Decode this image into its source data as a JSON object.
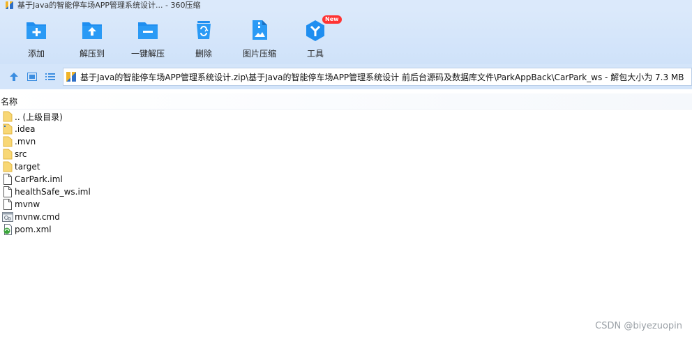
{
  "window": {
    "title": "基于Java的智能停车场APP管理系统设计... - 360压缩"
  },
  "toolbar": {
    "items": [
      {
        "label": "添加",
        "icon": "add-icon"
      },
      {
        "label": "解压到",
        "icon": "extract-to-icon"
      },
      {
        "label": "一键解压",
        "icon": "one-click-extract-icon"
      },
      {
        "label": "删除",
        "icon": "delete-icon"
      },
      {
        "label": "图片压缩",
        "icon": "image-compress-icon"
      },
      {
        "label": "工具",
        "icon": "tools-icon",
        "badge": "New"
      }
    ],
    "accent": "#1f8ef0"
  },
  "address": {
    "path": "基于Java的智能停车场APP管理系统设计.zip\\基于Java的智能停车场APP管理系统设计 前后台源码及数据库文件\\ParkAppBack\\CarPark_ws - 解包大小为 7.3 MB"
  },
  "list": {
    "column_name": "名称",
    "items": [
      {
        "name": ".. (上级目录)",
        "type": "folder"
      },
      {
        "name": ".idea",
        "type": "folder"
      },
      {
        "name": ".mvn",
        "type": "folder"
      },
      {
        "name": "src",
        "type": "folder"
      },
      {
        "name": "target",
        "type": "folder"
      },
      {
        "name": "CarPark.iml",
        "type": "file"
      },
      {
        "name": "healthSafe_ws.iml",
        "type": "file"
      },
      {
        "name": "mvnw",
        "type": "file"
      },
      {
        "name": "mvnw.cmd",
        "type": "cmd"
      },
      {
        "name": "pom.xml",
        "type": "xml"
      }
    ]
  },
  "watermark": "CSDN @biyezuopin"
}
